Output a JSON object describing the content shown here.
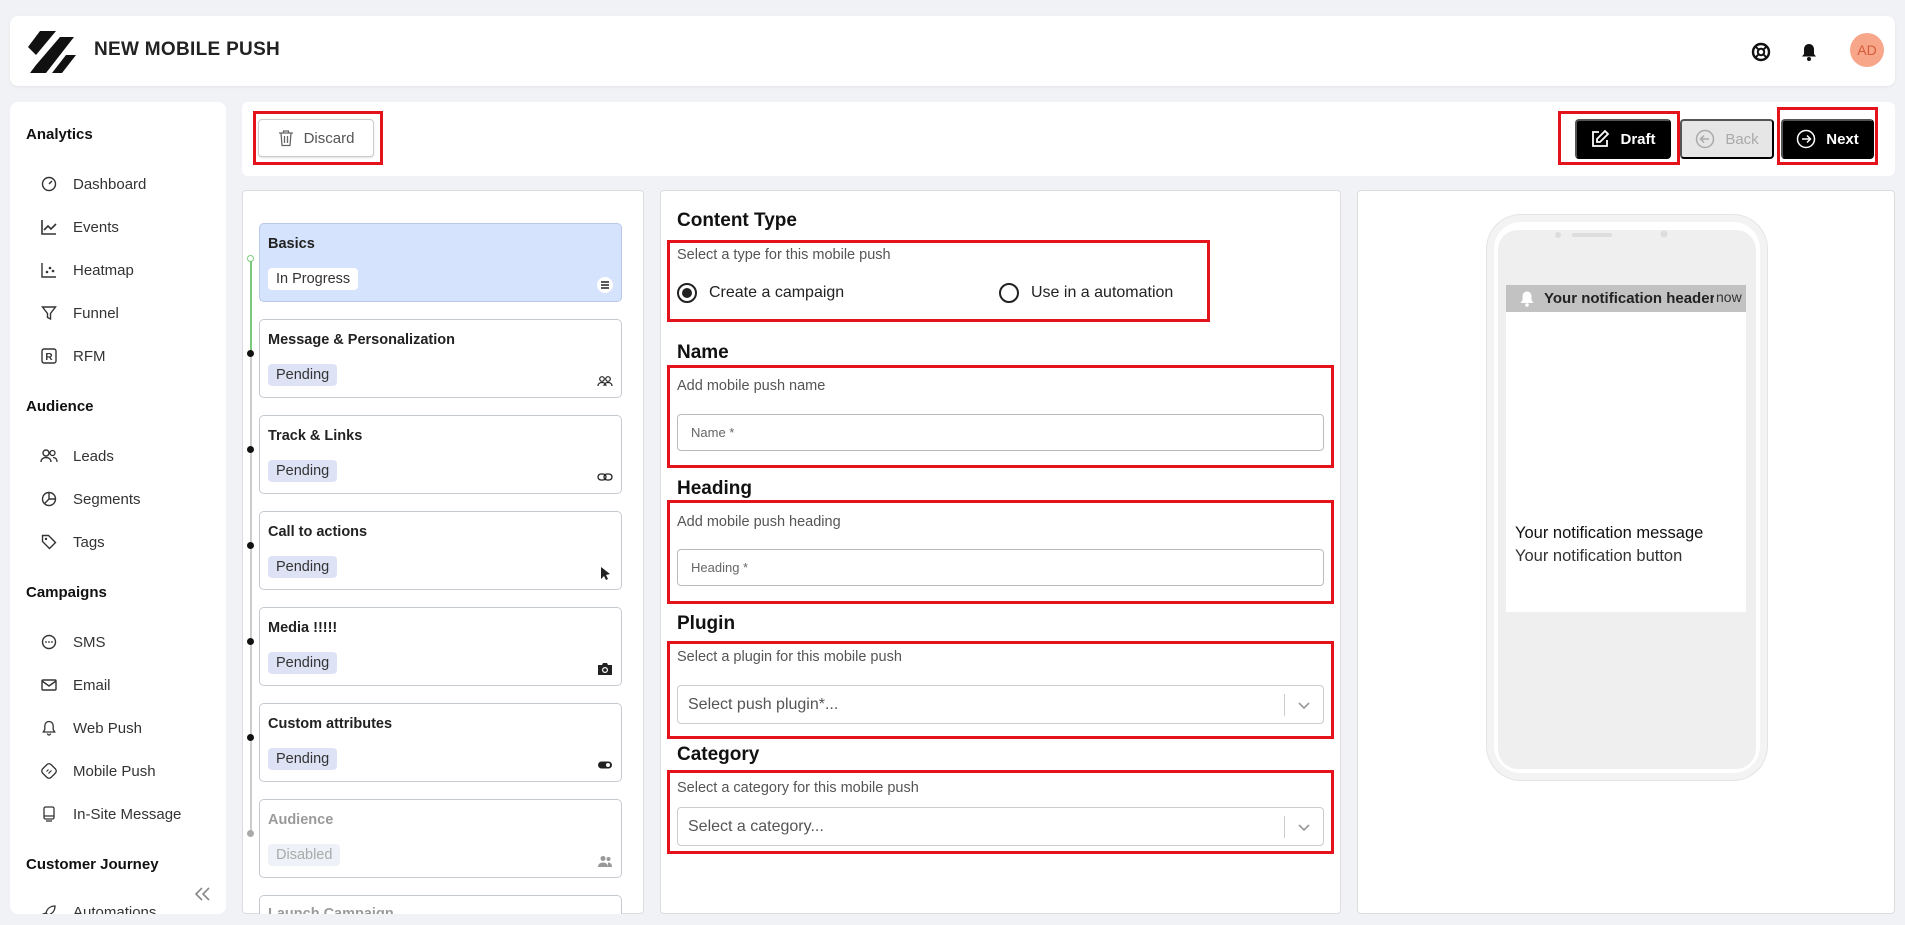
{
  "header": {
    "title": "NEW MOBILE PUSH",
    "avatar_initials": "AD",
    "icons": [
      "support-icon",
      "bell-icon"
    ]
  },
  "sidebar": {
    "sections": [
      {
        "label": "Analytics",
        "items": [
          {
            "label": "Dashboard",
            "icon": "gauge-icon"
          },
          {
            "label": "Events",
            "icon": "line-chart-icon"
          },
          {
            "label": "Heatmap",
            "icon": "scatter-icon"
          },
          {
            "label": "Funnel",
            "icon": "funnel-icon"
          },
          {
            "label": "RFM",
            "icon": "rfm-icon"
          }
        ]
      },
      {
        "label": "Audience",
        "items": [
          {
            "label": "Leads",
            "icon": "users-icon"
          },
          {
            "label": "Segments",
            "icon": "pie-icon"
          },
          {
            "label": "Tags",
            "icon": "tag-icon"
          }
        ]
      },
      {
        "label": "Campaigns",
        "items": [
          {
            "label": "SMS",
            "icon": "chat-icon"
          },
          {
            "label": "Email",
            "icon": "mail-icon"
          },
          {
            "label": "Web Push",
            "icon": "bell-icon"
          },
          {
            "label": "Mobile Push",
            "icon": "mobile-push-icon"
          },
          {
            "label": "In-Site Message",
            "icon": "monitor-icon"
          }
        ]
      },
      {
        "label": "Customer Journey",
        "items": [
          {
            "label": "Automations",
            "icon": "rocket-icon"
          }
        ]
      }
    ]
  },
  "toolbar": {
    "discard_label": "Discard",
    "draft_label": "Draft",
    "back_label": "Back",
    "next_label": "Next"
  },
  "steps": [
    {
      "title": "Basics",
      "status": "In Progress",
      "icon": "list-icon"
    },
    {
      "title": "Message & Personalization",
      "status": "Pending",
      "icon": "people-icon"
    },
    {
      "title": "Track & Links",
      "status": "Pending",
      "icon": "link-icon"
    },
    {
      "title": "Call to actions",
      "status": "Pending",
      "icon": "pointer-icon"
    },
    {
      "title": "Media !!!!!",
      "status": "Pending",
      "icon": "camera-icon"
    },
    {
      "title": "Custom attributes",
      "status": "Pending",
      "icon": "toggle-icon"
    },
    {
      "title": "Audience",
      "status": "Disabled",
      "icon": "group-icon"
    },
    {
      "title": "Launch Campaign",
      "status": "",
      "icon": ""
    }
  ],
  "form": {
    "content_type": {
      "title": "Content Type",
      "hint": "Select a type for this mobile push",
      "options": [
        "Create a campaign",
        "Use in a automation"
      ],
      "selected": "Create a campaign"
    },
    "name": {
      "title": "Name",
      "hint": "Add mobile push name",
      "placeholder": "Name *"
    },
    "heading": {
      "title": "Heading",
      "hint": "Add mobile push heading",
      "placeholder": "Heading *"
    },
    "plugin": {
      "title": "Plugin",
      "hint": "Select a plugin for this mobile push",
      "placeholder": "Select push plugin*..."
    },
    "category": {
      "title": "Category",
      "hint": "Select a category for this mobile push",
      "placeholder": "Select a category..."
    }
  },
  "preview": {
    "notification_header": "Your notification header",
    "notification_time": "now",
    "notification_message": "Your notification message",
    "notification_button": "Your notification button"
  },
  "colors": {
    "highlight": "#e3121b",
    "active_step": "#d6e3fd",
    "badge": "#dde3f5",
    "avatar": "#f8a68a"
  }
}
